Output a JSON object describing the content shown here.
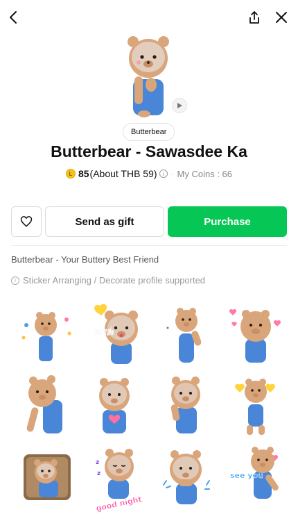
{
  "nav": {
    "back": "back-arrow-icon",
    "share": "share-icon",
    "close": "close-icon"
  },
  "sticker": {
    "author": "Butterbear",
    "title": "Butterbear - Sawasdee Ka",
    "price_coins": "85",
    "price_about": "(About THB 59)",
    "my_coins": "My Coins : 66",
    "description": "Butterbear - Your Buttery Best Friend",
    "feature": "Sticker Arranging / Decorate profile supported"
  },
  "actions": {
    "gift": "Send as gift",
    "purchase": "Purchase"
  },
  "sticker_texts": {
    "s2": "รับทราบค่ะ",
    "s10": "good night",
    "s12": "see you"
  },
  "colors": {
    "accent": "#06c755",
    "coin": "#f4c21a",
    "bear": "#d9a57a",
    "overalls": "#4a86d8"
  }
}
